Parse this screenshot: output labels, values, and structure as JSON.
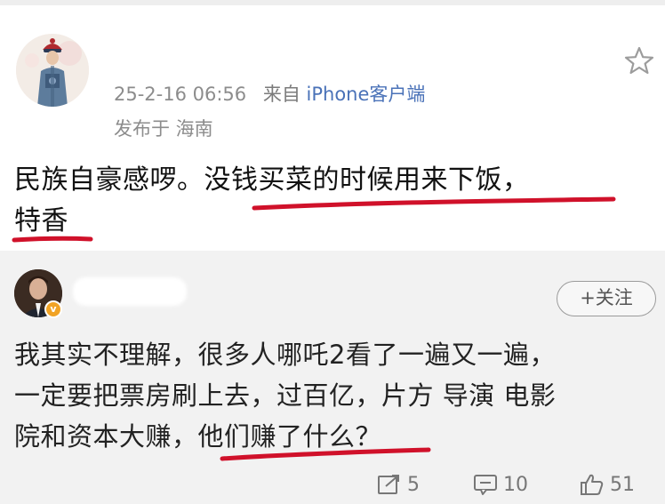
{
  "post": {
    "timestamp": "25-2-16 06:56",
    "source_prefix": "来自",
    "source_device": "iPhone客户端",
    "location": "发布于 海南",
    "text_plain": "民族自豪感啰。",
    "text_highlighted_1": "没钱买菜的时候用来下饭，",
    "text_highlighted_2": "特香"
  },
  "comment": {
    "follow_label": "+关注",
    "text_line_1": "我其实不理解，很多人哪吒2看了一遍又一遍，",
    "text_line_2": "一定要把票房刷上去，过百亿，片方 导演 电影",
    "text_line_3_plain": "院和资本大赚，",
    "text_line_3_highlighted": "他们赚了什么？",
    "badge": "v"
  },
  "actions": {
    "share_count": "5",
    "comment_count": "10",
    "like_count": "51"
  },
  "colors": {
    "underline": "#d0112a",
    "link_blue": "#4a72b8",
    "meta_gray": "#8c8c8c"
  },
  "icons": [
    "star-icon",
    "share-icon",
    "comment-icon",
    "like-icon",
    "vip-badge-icon"
  ]
}
